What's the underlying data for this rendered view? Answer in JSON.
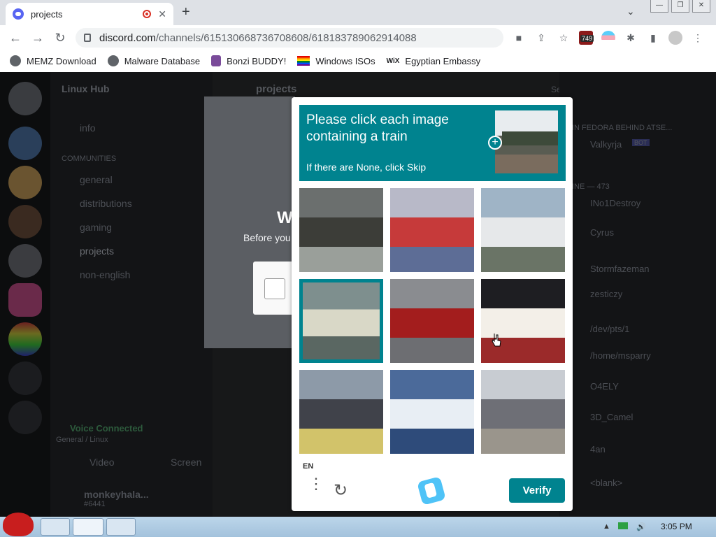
{
  "browser": {
    "tab_title": "projects",
    "tab_close": "✕",
    "newtab": "+",
    "url_domain": "discord.com",
    "url_path": "/channels/615130668736708608/618183789062914088",
    "extension_badge": "749",
    "bookmarks": [
      "MEMZ Download",
      "Malware Database",
      "Bonzi BUDDY!",
      "Windows ISOs",
      "Egyptian Embassy"
    ],
    "wix_label": "WiX"
  },
  "discord": {
    "server_name": "Linux Hub",
    "channel_header": "projects",
    "search_placeholder": "Search",
    "channels": [
      "info",
      "COMMUNITIES",
      "general",
      "distributions",
      "gaming",
      "projects",
      "non-english"
    ],
    "voice_status": "Voice Connected",
    "voice_sub": "General / Linux",
    "video_label": "Video",
    "screen_label": "Screen",
    "username": "monkeyhala...",
    "user_sub": "#6441",
    "members_heading": "IN FEDORA BEHIND ATSE...",
    "online_heading": "INE — 473",
    "members": [
      "Valkyrja",
      "INo1Destroy",
      "Cyrus",
      "Stormfazeman",
      "zesticzy",
      "/dev/pts/1",
      "/home/msparry",
      "O4ELY",
      "3D_Camel",
      "4an",
      "<blank>"
    ],
    "bot_tag": "BOT",
    "verify_heading": "W",
    "verify_before": "Before you"
  },
  "captcha": {
    "prompt": "Please click each image containing a train",
    "skip_hint": "If there are None, click Skip",
    "cells": [
      {
        "label": "bicycle",
        "selected": false,
        "colors": [
          "#6b6f6e",
          "#3c3d38",
          "#9a9f9a"
        ]
      },
      {
        "label": "bus",
        "selected": false,
        "colors": [
          "#b8b9c8",
          "#c63a3a",
          "#5d6d96"
        ]
      },
      {
        "label": "boat",
        "selected": false,
        "colors": [
          "#9fb4c6",
          "#e6e8ea",
          "#6a7466"
        ]
      },
      {
        "label": "train",
        "selected": true,
        "colors": [
          "#7e8f8e",
          "#d9d8c7",
          "#5a6762"
        ]
      },
      {
        "label": "fire truck",
        "selected": false,
        "colors": [
          "#8a8c90",
          "#a31d1d",
          "#6d6e72"
        ]
      },
      {
        "label": "bicycle",
        "selected": false,
        "colors": [
          "#1e1e22",
          "#f3efe8",
          "#9b2a2a"
        ]
      },
      {
        "label": "train",
        "selected": false,
        "colors": [
          "#8d9aa8",
          "#40424a",
          "#d2c36a"
        ]
      },
      {
        "label": "sailboat",
        "selected": false,
        "colors": [
          "#4b6a9a",
          "#e8eef4",
          "#2e4b7a"
        ]
      },
      {
        "label": "train",
        "selected": false,
        "colors": [
          "#c8ccd2",
          "#6e6f76",
          "#9a958c"
        ]
      }
    ],
    "language": "EN",
    "menu_icon": "⋮",
    "refresh_icon": "↻",
    "verify_label": "Verify",
    "accent": "#00838f"
  },
  "taskbar": {
    "clock": "3:05 PM"
  }
}
